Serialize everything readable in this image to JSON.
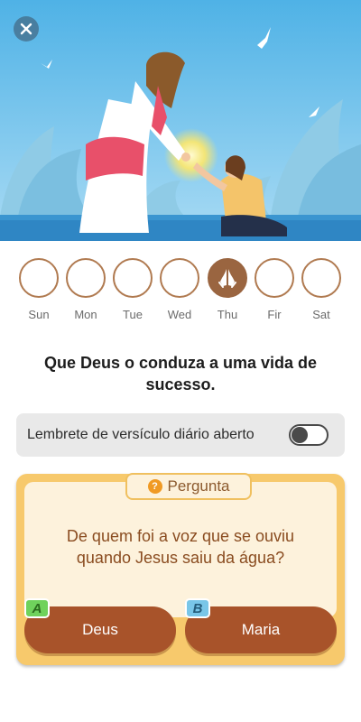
{
  "header": {
    "close_icon": "close-icon",
    "illustration": "jesus-healing-illustration"
  },
  "week": {
    "days": [
      {
        "label": "Sun",
        "active": false
      },
      {
        "label": "Mon",
        "active": false
      },
      {
        "label": "Tue",
        "active": false
      },
      {
        "label": "Wed",
        "active": false
      },
      {
        "label": "Thu",
        "active": true,
        "icon": "praying-hands-icon"
      },
      {
        "label": "Fir",
        "active": false
      },
      {
        "label": "Sat",
        "active": false
      }
    ]
  },
  "blessing": {
    "text": "Que Deus o conduza a uma vida de sucesso."
  },
  "reminder": {
    "label": "Lembrete de versículo diário aberto",
    "enabled": false
  },
  "quiz": {
    "tag_label": "Pergunta",
    "tag_icon": "question-icon",
    "question": "De quem foi a voz que se ouviu quando Jesus saiu da água?",
    "answers": [
      {
        "letter": "A",
        "label": "Deus"
      },
      {
        "letter": "B",
        "label": "Maria"
      }
    ]
  },
  "colors": {
    "sky": "#5cb8e8",
    "accent_brown": "#a8532a",
    "card_yellow": "#f7c96c",
    "card_inner": "#fdf2dc",
    "day_border": "#b07a50"
  }
}
